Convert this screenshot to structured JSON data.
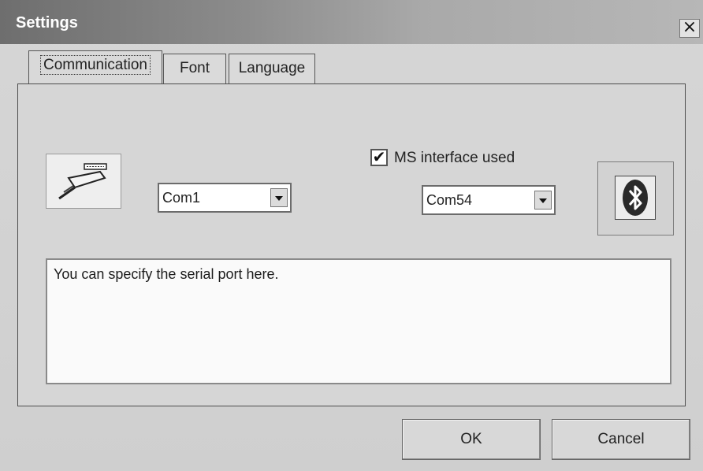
{
  "window": {
    "title": "Settings",
    "close_label": "×"
  },
  "tabs": [
    {
      "label": "Communication",
      "active": true
    },
    {
      "label": "Font",
      "active": false
    },
    {
      "label": "Language",
      "active": false
    }
  ],
  "communication": {
    "serial_port": {
      "selected": "Com1"
    },
    "ms_interface": {
      "label": "MS interface used",
      "checked": true,
      "check_glyph": "✔"
    },
    "ms_port": {
      "selected": "Com54"
    },
    "icons": {
      "left": "serial-cable-icon",
      "right": "bluetooth-icon"
    },
    "info_text": "You can specify the serial port here."
  },
  "buttons": {
    "ok_label": "OK",
    "cancel_label": "Cancel"
  }
}
